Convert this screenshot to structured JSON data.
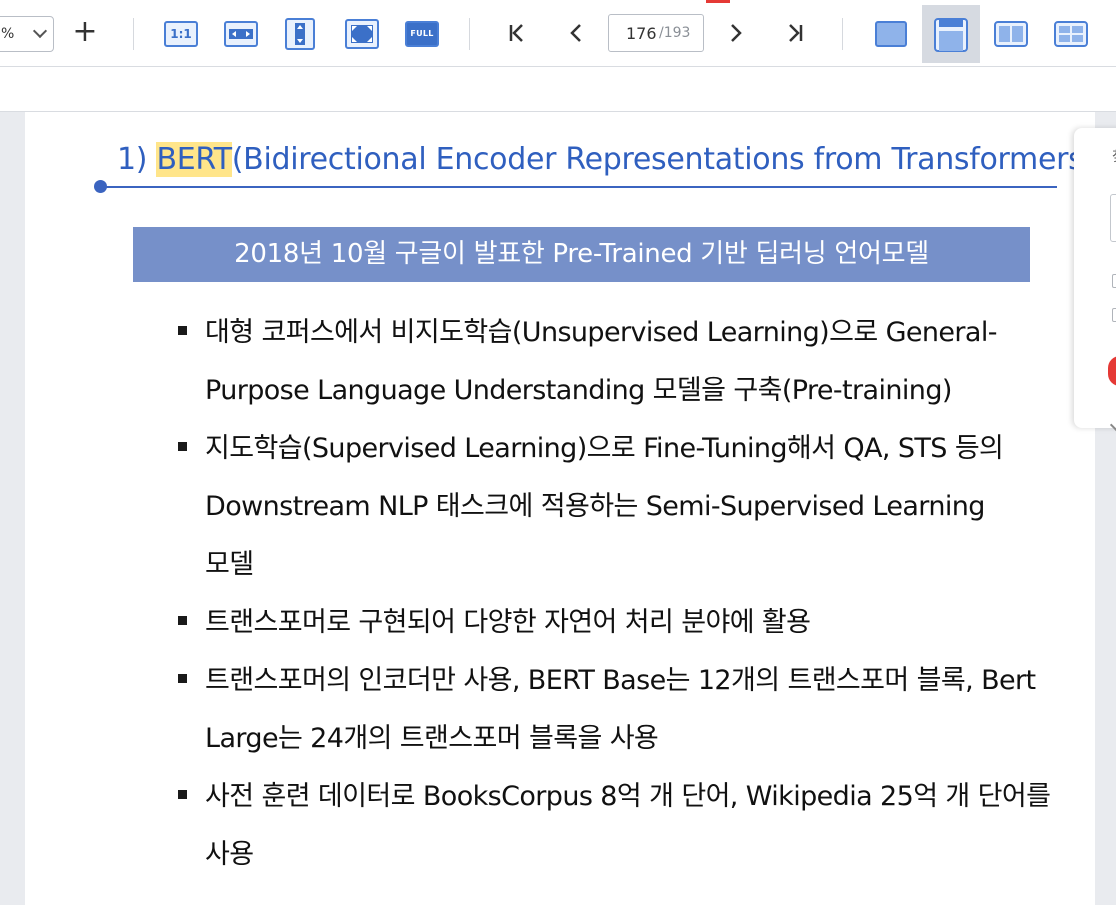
{
  "toolbar": {
    "zoom_value": "%",
    "zoom_in_label": "+",
    "actual_size_label": "1:1",
    "full_label": "FULL",
    "first_label": "I<",
    "prev_label": "<",
    "next_label": ">",
    "last_label": ">I",
    "current_page": "176",
    "total_pages": "/193"
  },
  "document": {
    "heading_number": "1) ",
    "heading_highlight": "BERT",
    "heading_rest": "(Bidirectional Encoder Representations from Transformers)",
    "banner": "2018년 10월 구글이 발표한 Pre-Trained 기반 딥러닝 언어모델",
    "bullets": [
      "대형 코퍼스에서 비지도학습(Unsupervised Learning)으로 General-\nPurpose Language Understanding 모델을 구축(Pre-training)",
      "지도학습(Supervised Learning)으로 Fine-Tuning해서 QA, STS 등의\nDownstream NLP 태스크에 적용하는 Semi-Supervised Learning\n모델",
      "트랜스포머로 구현되어 다양한 자연어 처리 분야에 활용",
      "트랜스포머의 인코더만 사용, BERT Base는 12개의 트랜스포머 블록, Bert\nLarge는 24개의 트랜스포머 블록을 사용",
      "사전 훈련 데이터로 BooksCorpus 8억 개 단어,  Wikipedia 25억 개 단어를\n사용"
    ]
  },
  "side_panel": {
    "top_char": "찾"
  },
  "colors": {
    "accent": "#3b70c8",
    "heading": "#2f5fbf",
    "banner": "#7690c9",
    "highlight": "#ffe58a"
  }
}
